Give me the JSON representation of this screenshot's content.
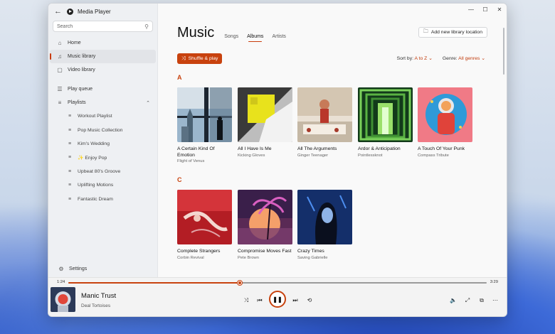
{
  "app": {
    "title": "Media Player"
  },
  "titlebar": {
    "back": "←",
    "minimize": "—",
    "maximize": "☐",
    "close": "✕"
  },
  "search": {
    "placeholder": "Search",
    "icon": "search-icon"
  },
  "sidebar": {
    "items": [
      {
        "label": "Home",
        "icon": "home-icon"
      },
      {
        "label": "Music library",
        "icon": "music-note-icon",
        "active": true
      },
      {
        "label": "Video library",
        "icon": "video-icon"
      },
      {
        "label": "Play queue",
        "icon": "queue-icon"
      },
      {
        "label": "Playlists",
        "icon": "playlist-icon"
      }
    ],
    "playlists": [
      "Workout Playlist",
      "Pop Music Collection",
      "Kim's Wedding",
      "✨ Enjoy Pop",
      "Upbeat 80's Groove",
      "Uplifting Motions",
      "Fantastic Dream"
    ],
    "settings": "Settings"
  },
  "main": {
    "title": "Music",
    "tabs": [
      "Songs",
      "Albums",
      "Artists"
    ],
    "active_tab": "Albums",
    "add_location": "Add new library location",
    "shuffle": "Shuffle & play",
    "sort_label": "Sort by:",
    "sort_value": "A to Z",
    "genre_label": "Genre:",
    "genre_value": "All genres",
    "sections": [
      {
        "letter": "A",
        "albums": [
          {
            "title": "A Certain Kind Of Emotion",
            "artist": "Flight of Venus"
          },
          {
            "title": "All I Have Is Me",
            "artist": "Kicking Gloves"
          },
          {
            "title": "All The Arguments",
            "artist": "Ginger Teenager"
          },
          {
            "title": "Ardor & Anticipation",
            "artist": "Pointlessknot"
          },
          {
            "title": "A Touch Of Your Punk",
            "artist": "Compass Tribute"
          }
        ]
      },
      {
        "letter": "C",
        "albums": [
          {
            "title": "Complete Strangers",
            "artist": "Corbin Revival"
          },
          {
            "title": "Compromise Moves Fast",
            "artist": "Pete Brown"
          },
          {
            "title": "Crazy Times",
            "artist": "Saving Gabrielle"
          }
        ]
      }
    ]
  },
  "player": {
    "elapsed": "1:24",
    "total": "3:29",
    "progress": 0.41,
    "title": "Manic Trust",
    "artist": "Deal Tortoises",
    "accent": "#c8420e"
  }
}
